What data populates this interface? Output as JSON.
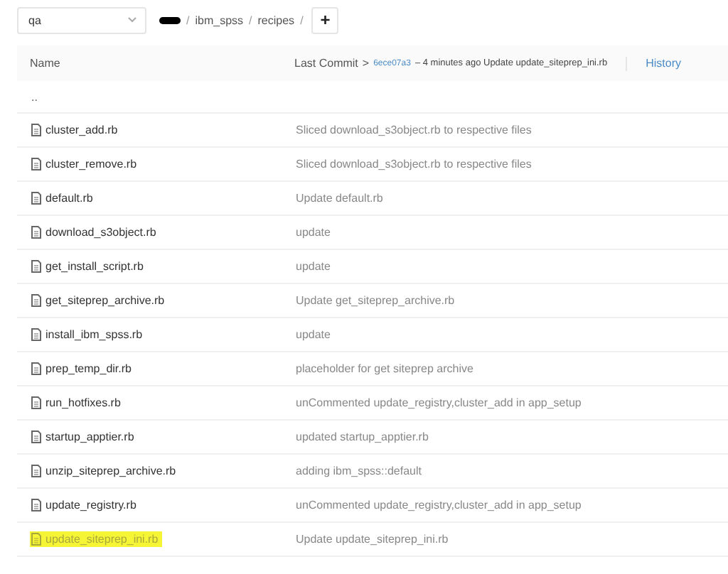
{
  "branch_select": {
    "value": "qa"
  },
  "breadcrumb": {
    "redacted": true,
    "segments": [
      "ibm_spss",
      "recipes"
    ],
    "separator": "/",
    "add_button": "+"
  },
  "table": {
    "columns": [
      "Name",
      "Last Commit"
    ],
    "last_commit": {
      "arrow": ">",
      "hash": "6ece07a3",
      "summary": "– 4 minutes ago Update update_siteprep_ini.rb",
      "history_link": "History"
    },
    "parent_row": "..",
    "rows": [
      {
        "name": "cluster_add.rb",
        "message": "Sliced download_s3object.rb to respective files",
        "highlighted": false
      },
      {
        "name": "cluster_remove.rb",
        "message": "Sliced download_s3object.rb to respective files",
        "highlighted": false
      },
      {
        "name": "default.rb",
        "message": "Update default.rb",
        "highlighted": false
      },
      {
        "name": "download_s3object.rb",
        "message": "update",
        "highlighted": false
      },
      {
        "name": "get_install_script.rb",
        "message": "update",
        "highlighted": false
      },
      {
        "name": "get_siteprep_archive.rb",
        "message": "Update get_siteprep_archive.rb",
        "highlighted": false
      },
      {
        "name": "install_ibm_spss.rb",
        "message": "update",
        "highlighted": false
      },
      {
        "name": "prep_temp_dir.rb",
        "message": "placeholder for get siteprep archive",
        "highlighted": false
      },
      {
        "name": "run_hotfixes.rb",
        "message": "unCommented update_registry,cluster_add in app_setup",
        "highlighted": false
      },
      {
        "name": "startup_apptier.rb",
        "message": "updated startup_apptier.rb",
        "highlighted": false
      },
      {
        "name": "unzip_siteprep_archive.rb",
        "message": "adding ibm_spss::default",
        "highlighted": false
      },
      {
        "name": "update_registry.rb",
        "message": "unCommented update_registry,cluster_add in app_setup",
        "highlighted": false
      },
      {
        "name": "update_siteprep_ini.rb",
        "message": "Update update_siteprep_ini.rb",
        "highlighted": true
      }
    ]
  }
}
